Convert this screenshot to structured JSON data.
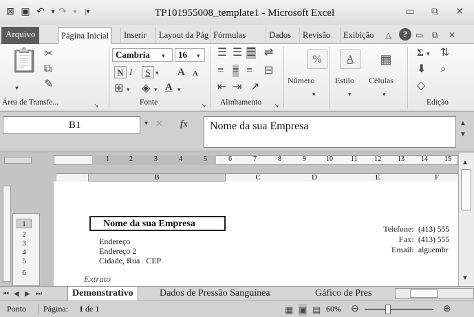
{
  "window": {
    "title": "TP101955008_template1 - Microsoft Excel"
  },
  "tabs": [
    "Arquivo",
    "Página Inicial",
    "Inserir",
    "Layout da Pág",
    "Fórmulas",
    "Dados",
    "Revisão",
    "Exibição"
  ],
  "ribbon": {
    "clipboard_label": "Área de Transfe...",
    "font_label": "Fonte",
    "font_name": "Cambria",
    "font_size": "16",
    "bold": "N",
    "italic": "I",
    "underline": "S",
    "grow_font": "A",
    "shrink_font": "A",
    "font_color": "A",
    "alignment_label": "Alinhamento",
    "number_label": "Número",
    "number_icon": "%",
    "style_label": "Estilo",
    "cells_label": "Células",
    "editing_label": "Edição",
    "sum_icon": "Σ"
  },
  "formula_bar": {
    "cell_ref": "B1",
    "fx": "fx",
    "content": "Nome da sua Empresa"
  },
  "ruler": {
    "numbers": [
      "1",
      "2",
      "3",
      "4",
      "5",
      "6",
      "7",
      "8",
      "9",
      "10",
      "11",
      "12",
      "13",
      "14",
      "15"
    ],
    "columns": [
      "B",
      "C",
      "D",
      "E",
      "F"
    ]
  },
  "rows": [
    "1",
    "2",
    "3",
    "4",
    "5",
    "6"
  ],
  "sheet": {
    "company": "Nome da sua Empresa",
    "address": "Endereço",
    "address2": "Endereço 2",
    "city": "Cidade, Rua   CEP",
    "extract": "Extrato",
    "phone_label": "Telefone:",
    "phone_value": "(413) 555",
    "fax_label": "Fax:",
    "fax_value": "(413) 555",
    "email_label": "Email:",
    "email_value": "alguembr"
  },
  "sheet_tabs": [
    "Demonstrativo",
    "Dados de Pressão Sanguínea",
    "Gáfico de Pres"
  ],
  "status": {
    "mode": "Ponto",
    "page_prefix": "Página:",
    "page_num": "1",
    "page_suffix": "de 1",
    "zoom": "60%"
  }
}
